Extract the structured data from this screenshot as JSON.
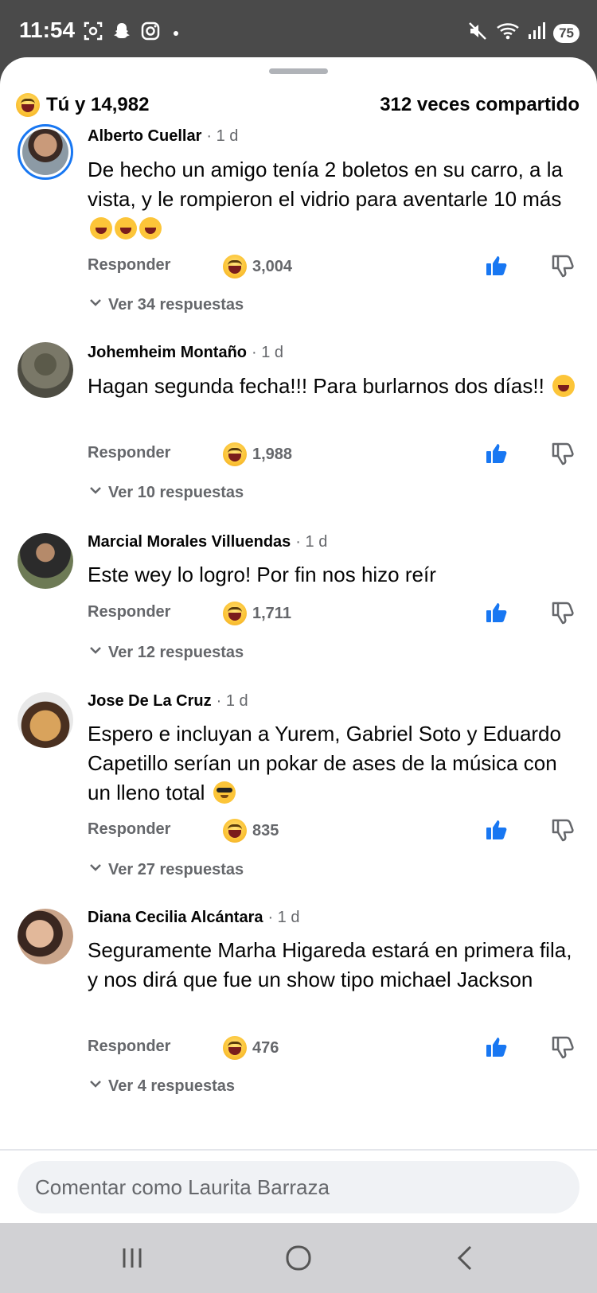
{
  "status_bar": {
    "time": "11:54",
    "battery": "75",
    "icons_left": [
      "screenshot-icon",
      "snapchat-icon",
      "instagram-icon"
    ],
    "icons_right": [
      "mute-icon",
      "wifi-icon",
      "signal-icon"
    ]
  },
  "summary": {
    "reactions": "Tú y 14,982",
    "shares": "312 veces compartido"
  },
  "comments": [
    {
      "author": "Alberto Cuellar",
      "time": "· 1 d",
      "text": "De hecho un amigo tenía 2 boletos en su carro, a la vista, y le rompieron el vidrio para aventarle 10 más",
      "reply_label": "Responder",
      "reaction_count": "3,004",
      "view_replies": "Ver 34 respuestas"
    },
    {
      "author": "Johemheim Montaño",
      "time": "· 1 d",
      "text": "Hagan segunda fecha!!! Para burlarnos dos días!!",
      "reply_label": "Responder",
      "reaction_count": "1,988",
      "view_replies": "Ver 10 respuestas"
    },
    {
      "author": "Marcial Morales Villuendas",
      "time": "· 1 d",
      "text": "Este wey lo logro! Por fin nos hizo reír",
      "reply_label": "Responder",
      "reaction_count": "1,711",
      "view_replies": "Ver 12 respuestas"
    },
    {
      "author": "Jose De La Cruz",
      "time": "· 1 d",
      "text": "Espero e incluyan a Yurem, Gabriel Soto y Eduardo Capetillo serían un pokar de ases de la música con un lleno total",
      "reply_label": "Responder",
      "reaction_count": "835",
      "view_replies": "Ver 27 respuestas"
    },
    {
      "author": "Diana Cecilia Alcántara",
      "time": "· 1 d",
      "text": "Seguramente Marha Higareda estará en primera fila, y nos dirá que fue un show tipo michael Jackson",
      "reply_label": "Responder",
      "reaction_count": "476",
      "view_replies": "Ver 4 respuestas"
    }
  ],
  "composer": {
    "placeholder": "Comentar como Laurita Barraza"
  },
  "colors": {
    "accent": "#1877f2",
    "secondary_text": "#65676b",
    "status_bar": "#4a4a4a"
  }
}
